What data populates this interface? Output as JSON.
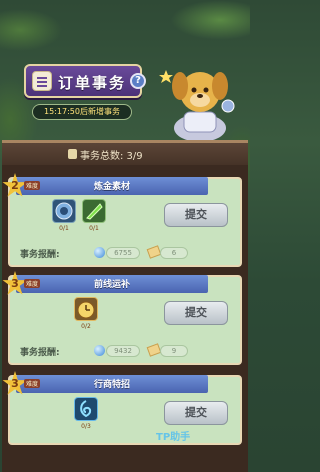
{
  "header": {
    "title": "订单事务",
    "help": "?",
    "timer": "15:17:50后新增事务"
  },
  "summary": {
    "label": "事务总数: 3/9"
  },
  "tasks": [
    {
      "level": "2",
      "difficulty": "难度",
      "name": "炼金素材",
      "items": [
        {
          "icon": "target-orb-icon",
          "count": "0/1"
        },
        {
          "icon": "green-blade-icon",
          "count": "0/1"
        }
      ],
      "submit": "提交",
      "reward_label": "事务报酬:",
      "rewards": [
        {
          "icon": "gem-icon",
          "value": "6755"
        },
        {
          "icon": "ticket-icon",
          "value": "6"
        }
      ]
    },
    {
      "level": "3",
      "difficulty": "难度",
      "name": "前线运补",
      "items": [
        {
          "icon": "clock-icon",
          "count": "0/2"
        }
      ],
      "submit": "提交",
      "reward_label": "事务报酬:",
      "rewards": [
        {
          "icon": "gem-icon",
          "value": "9432"
        },
        {
          "icon": "ticket-icon",
          "value": "9"
        }
      ]
    },
    {
      "level": "3",
      "difficulty": "难度",
      "name": "行商特招",
      "items": [
        {
          "icon": "water-swirl-icon",
          "count": "0/3"
        }
      ],
      "submit": "提交"
    }
  ],
  "watermark": "TP助手",
  "colors": {
    "ribbon": "#5a78c4",
    "card": "#c9e3bf",
    "star": "#f1c23a",
    "title_board": "#5a3d88"
  }
}
